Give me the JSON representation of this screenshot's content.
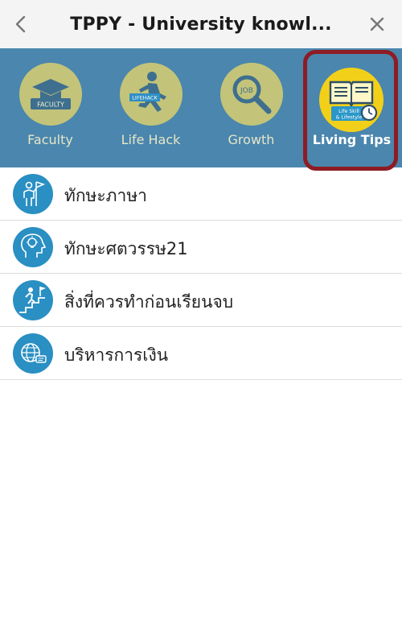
{
  "header": {
    "title": "TPPY - University knowl...",
    "back_icon": "chevron-left-icon",
    "close_icon": "close-icon"
  },
  "categories": [
    {
      "label": "Faculty",
      "badge": "FACULTY",
      "icon": "graduation-cap-icon",
      "active": false
    },
    {
      "label": "Life Hack",
      "badge": "LIFEHACK",
      "icon": "running-person-icon",
      "active": false
    },
    {
      "label": "Growth",
      "badge": "JOB",
      "icon": "magnifier-job-icon",
      "active": false
    },
    {
      "label": "Living Tips",
      "badge_line1": "Life Skill",
      "badge_line2": "& Lifestyle",
      "icon": "book-clock-icon",
      "active": true
    }
  ],
  "list": [
    {
      "label": "ทักษะภาษา",
      "icon": "person-flag-icon"
    },
    {
      "label": "ทักษะศตวรรษ21",
      "icon": "head-lightbulb-icon"
    },
    {
      "label": "สิ่งที่ควรทำก่อนเรียนจบ",
      "icon": "person-climbing-stairs-icon"
    },
    {
      "label": "บริหารการเงิน",
      "icon": "globe-chat-icon"
    }
  ],
  "colors": {
    "header_bg": "#f4f4f4",
    "category_bar_bg": "#4a86ad",
    "inactive_circle": "#c3c479",
    "active_circle": "#f2d01a",
    "active_frame": "#8e1c24",
    "list_icon_bg": "#2a8fc3"
  }
}
